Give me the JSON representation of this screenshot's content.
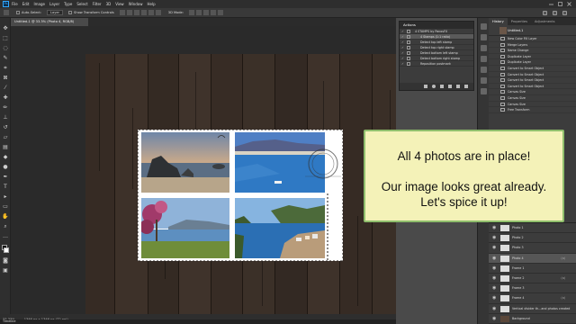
{
  "app": {
    "logo": "Ps"
  },
  "menubar": {
    "items": [
      "File",
      "Edit",
      "Image",
      "Layer",
      "Type",
      "Select",
      "Filter",
      "3D",
      "View",
      "Window",
      "Help"
    ]
  },
  "options": {
    "auto_select_label": "Auto-Select:",
    "auto_select_value": "Layer",
    "show_transform_label": "Show Transform Controls",
    "mode_label": "3D Mode:"
  },
  "document": {
    "tab_title": "Untitled-1 @ 33.3% (Photo 4, RGB/8)"
  },
  "status": {
    "zoom": "33.33%",
    "doc_size": "1346 px x 1346 px (72 ppi)"
  },
  "timeline": {
    "label": "Timeline"
  },
  "actions": {
    "title": "Actions",
    "rows": [
      {
        "label": "4 STAMPS by PanosFX",
        "selected": false
      },
      {
        "label": "4 Stamps (1:1 ratio)",
        "selected": true
      },
      {
        "label": "Detect top left stamp",
        "selected": false
      },
      {
        "label": "Detect top right stamp",
        "selected": false
      },
      {
        "label": "Detect bottom left stamp",
        "selected": false
      },
      {
        "label": "Detect bottom right stamp",
        "selected": false
      },
      {
        "label": "Reposition postmark",
        "selected": false
      }
    ]
  },
  "history": {
    "tabs": [
      "History",
      "Properties",
      "Adjustments"
    ],
    "snapshot": "Untitled-1",
    "rows": [
      "New Color Fill Layer",
      "Merge Layers",
      "Name Change",
      "Duplicate Layer",
      "Duplicate Layer",
      "Convert to Smart Object",
      "Convert to Smart Object",
      "Convert to Smart Object",
      "Convert to Smart Object",
      "Canvas Size",
      "Canvas Size",
      "Canvas Size",
      "Free Transform"
    ]
  },
  "layers": {
    "rows": [
      {
        "name": "Photo 1",
        "fx": "",
        "selected": false
      },
      {
        "name": "Photo 2",
        "fx": "",
        "selected": false
      },
      {
        "name": "Photo 3",
        "fx": "",
        "selected": false
      },
      {
        "name": "Photo 4",
        "fx": "(a)",
        "selected": true
      },
      {
        "name": "Frame 1",
        "fx": "",
        "selected": false
      },
      {
        "name": "Frame 2",
        "fx": "(a)",
        "selected": false
      },
      {
        "name": "Frame 3",
        "fx": "",
        "selected": false
      },
      {
        "name": "Frame 4",
        "fx": "(a)",
        "selected": false
      },
      {
        "name": "Vertical divider th...and photos created",
        "fx": "",
        "selected": false
      },
      {
        "name": "Background",
        "fx": "",
        "selected": false
      }
    ]
  },
  "callout": {
    "line1": "All 4 photos are in place!",
    "line2": "Our image looks great already.",
    "line3": "Let's spice it up!"
  },
  "colors": {
    "accent": "#31a8ff",
    "callout_bg": "#f4f2b8",
    "callout_border": "#8fbe6c",
    "wood": "#3a2f28"
  }
}
